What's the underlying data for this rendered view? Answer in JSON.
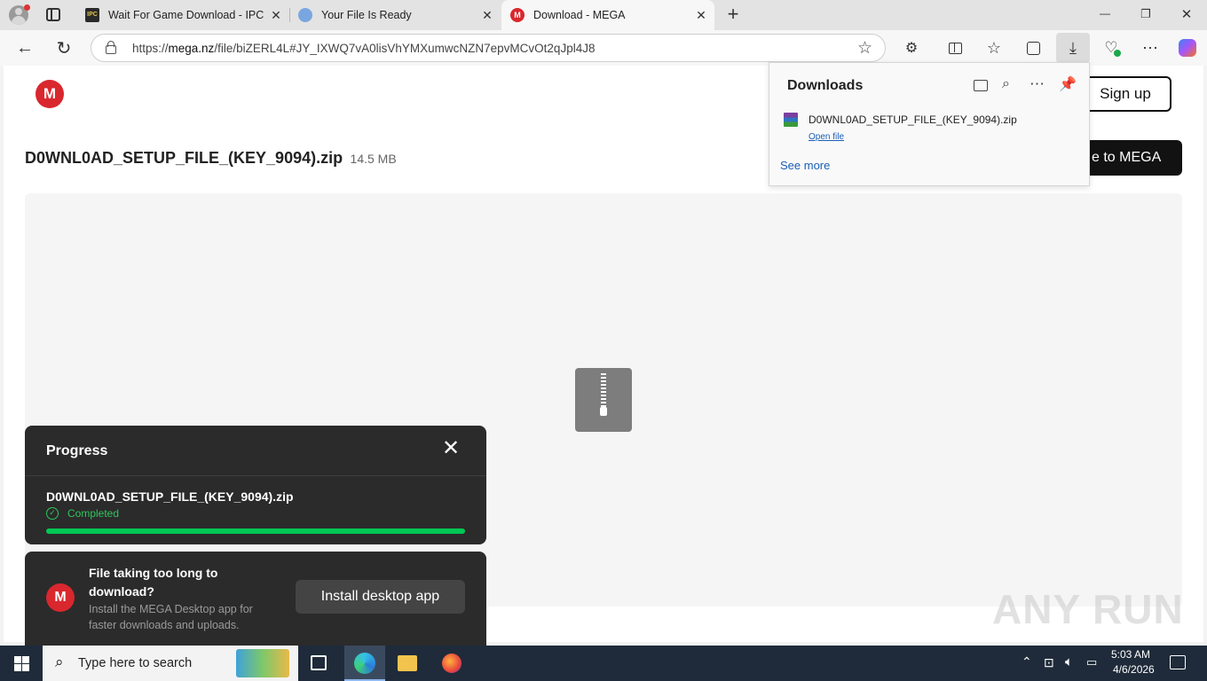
{
  "browser": {
    "tabs": [
      {
        "title": "Wait For Game Download - IPC G",
        "close": "✕"
      },
      {
        "title": "Your File Is Ready",
        "close": "✕"
      },
      {
        "title": "Download - MEGA",
        "close": "✕"
      }
    ],
    "new_tab": "+",
    "url_domain": "mega.nz",
    "url_prefix": "https://",
    "url_path": "/file/biZERL4L#JY_IXWQ7vA0lisVhYMXumwcNZN7epvMCvOt2qJpl4J8",
    "window_controls": {
      "minimize": "—",
      "restore": "❐",
      "close": "✕"
    }
  },
  "downloads_panel": {
    "title": "Downloads",
    "item_name": "D0WNL0AD_SETUP_FILE_(KEY_9094).zip",
    "item_action": "Open file",
    "see_more": "See more"
  },
  "mega": {
    "logo_letter": "M",
    "signup": "Sign up",
    "save_button": "e to MEGA",
    "file_name": "D0WNL0AD_SETUP_FILE_(KEY_9094).zip",
    "file_size": "14.5 MB"
  },
  "progress": {
    "title": "Progress",
    "file": "D0WNL0AD_SETUP_FILE_(KEY_9094).zip",
    "status": "Completed",
    "fraction": 1.0
  },
  "promo": {
    "headline": "File taking too long to download?",
    "body": "Install the MEGA Desktop app for faster downloads and uploads.",
    "button": "Install desktop app"
  },
  "watermark": "ANY RUN",
  "taskbar": {
    "search_placeholder": "Type here to search",
    "time": "5:03 AM",
    "date": "4/6/2026"
  },
  "colors": {
    "mega_red": "#d9272e",
    "progress_green": "#00c853",
    "link_blue": "#1a5fb4",
    "taskbar": "#1f2b3a"
  }
}
